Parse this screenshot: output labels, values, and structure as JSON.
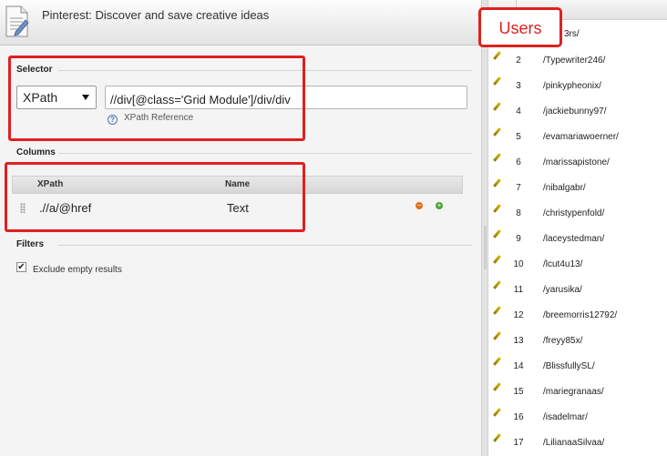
{
  "window": {
    "title": "Pinterest: Discover and save creative ideas"
  },
  "selector": {
    "section_label": "Selector",
    "type_value": "XPath",
    "xpath_value": "//div[@class='Grid Module']/div/div",
    "reference_link": "XPath Reference"
  },
  "columns": {
    "section_label": "Columns",
    "headers": [
      "XPath",
      "Name"
    ],
    "rows": [
      {
        "xpath": ".//a/@href",
        "name": "Text"
      }
    ]
  },
  "filters": {
    "section_label": "Filters",
    "exclude_empty_label": "Exclude empty results",
    "exclude_empty_checked": true
  },
  "users_panel": {
    "annotation_label": "Users",
    "partial_first_row": "3rs/",
    "rows": [
      {
        "num": "2",
        "name": "/Typewriter246/"
      },
      {
        "num": "3",
        "name": "/pinkypheonix/"
      },
      {
        "num": "4",
        "name": "/jackiebunny97/"
      },
      {
        "num": "5",
        "name": "/evamariawoerner/"
      },
      {
        "num": "6",
        "name": "/marissapistone/"
      },
      {
        "num": "7",
        "name": "/nibalgabr/"
      },
      {
        "num": "8",
        "name": "/christypenfold/"
      },
      {
        "num": "9",
        "name": "/laceystedman/"
      },
      {
        "num": "10",
        "name": "/lcut4u13/"
      },
      {
        "num": "11",
        "name": "/yarusika/"
      },
      {
        "num": "12",
        "name": "/breemorris12792/"
      },
      {
        "num": "13",
        "name": "/freyy85x/"
      },
      {
        "num": "14",
        "name": "/BlissfullySL/"
      },
      {
        "num": "15",
        "name": "/mariegranaas/"
      },
      {
        "num": "16",
        "name": "/isadelmar/"
      },
      {
        "num": "17",
        "name": "/LilianaaSilvaa/"
      }
    ]
  },
  "colors": {
    "annotation_red": "#e02020",
    "remove_orange": "#e2701f",
    "add_green": "#4aa534"
  }
}
